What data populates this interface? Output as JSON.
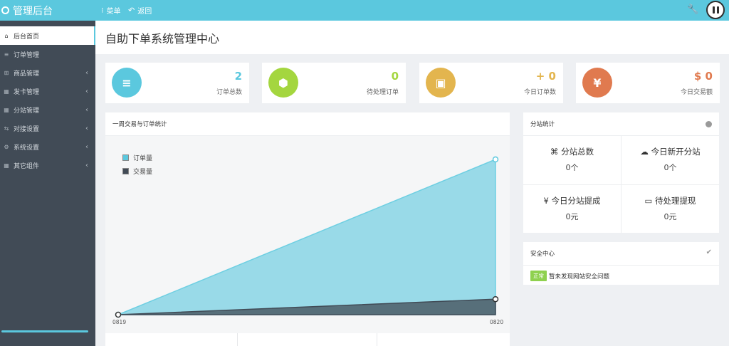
{
  "app": {
    "brand": "管理后台",
    "menu_label": "菜单",
    "back_label": "返回"
  },
  "sidebar": {
    "items": [
      {
        "label": "后台首页",
        "icon": "home-icon",
        "active": true,
        "arrow": false
      },
      {
        "label": "订单管理",
        "icon": "list-icon",
        "active": false,
        "arrow": false
      },
      {
        "label": "商品管理",
        "icon": "cart-icon",
        "active": false,
        "arrow": true
      },
      {
        "label": "发卡管理",
        "icon": "grid-icon",
        "active": false,
        "arrow": true
      },
      {
        "label": "分站管理",
        "icon": "grid-icon",
        "active": false,
        "arrow": true
      },
      {
        "label": "对接设置",
        "icon": "link-icon",
        "active": false,
        "arrow": true
      },
      {
        "label": "系统设置",
        "icon": "gear-icon",
        "active": false,
        "arrow": true
      },
      {
        "label": "其它组件",
        "icon": "grid-icon",
        "active": false,
        "arrow": true
      }
    ]
  },
  "page": {
    "title": "自助下单系统管理中心"
  },
  "stats": [
    {
      "value": "2",
      "label": "订单总数",
      "color": "#5bc8de",
      "icon": "list-icon"
    },
    {
      "value": "0",
      "label": "待处理订单",
      "color": "#a4d63f",
      "icon": "cube-icon"
    },
    {
      "value": "+ 0",
      "label": "今日订单数",
      "color": "#e3b54e",
      "icon": "briefcase-icon"
    },
    {
      "value": "$ 0",
      "label": "今日交易额",
      "color": "#e07a4f",
      "icon": "yen-icon"
    }
  ],
  "chart_panel": {
    "title": "一周交易与订单统计"
  },
  "chart_data": {
    "type": "area",
    "x": [
      "0819",
      "0820"
    ],
    "series": [
      {
        "name": "订单量",
        "values": [
          0,
          2
        ],
        "color": "#5bc8de"
      },
      {
        "name": "交易量",
        "values": [
          0,
          0.2
        ],
        "color": "#414b56"
      }
    ],
    "ylim": [
      0,
      2.1
    ]
  },
  "substation": {
    "title": "分站统计",
    "cells": [
      {
        "icon": "sitemap-icon",
        "title": "分站总数",
        "value": "0个"
      },
      {
        "icon": "cloud-icon",
        "title": "今日新开分站",
        "value": "0个"
      },
      {
        "icon": "yen-icon",
        "title": "今日分站提成",
        "value": "0元"
      },
      {
        "icon": "money-icon",
        "title": "待处理提现",
        "value": "0元"
      }
    ]
  },
  "security": {
    "title": "安全中心",
    "badge": "正常",
    "message": "暂未发现网站安全问题"
  }
}
